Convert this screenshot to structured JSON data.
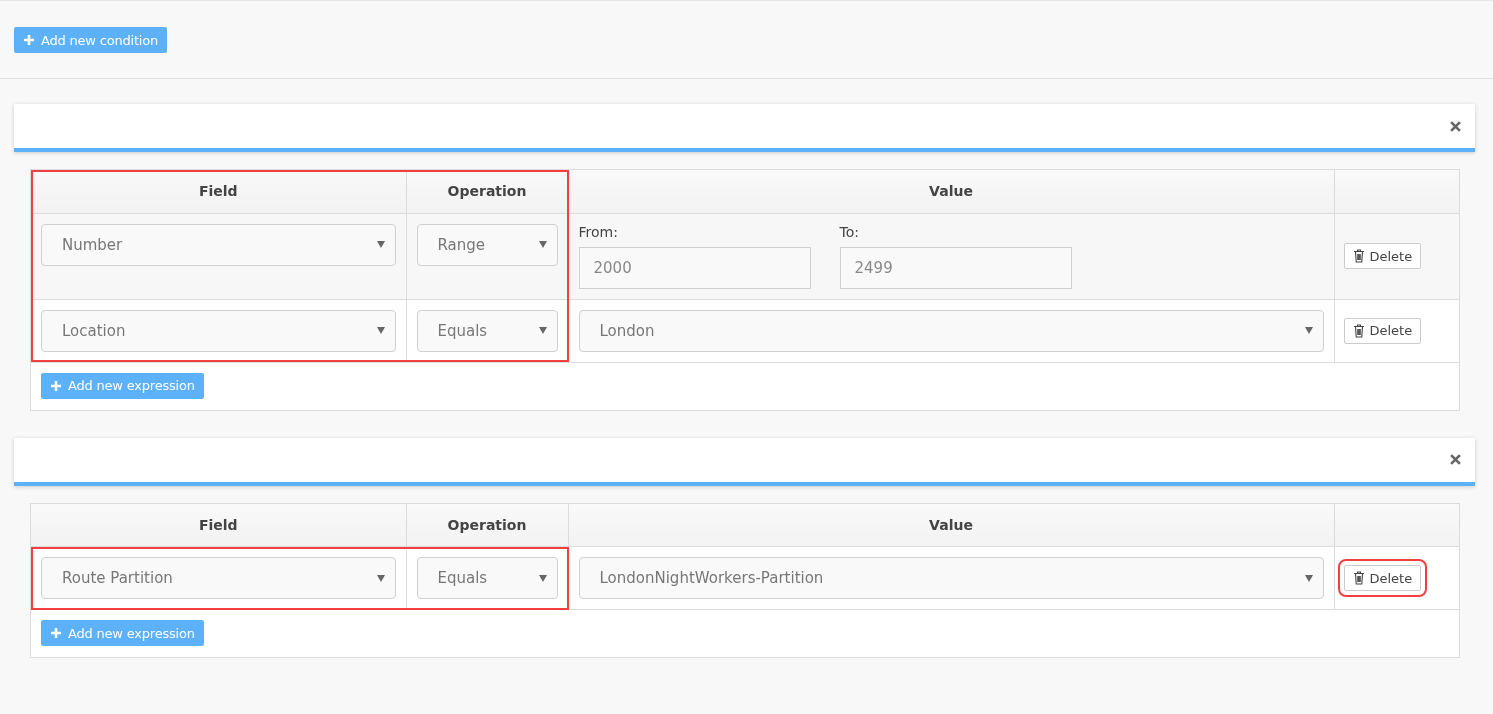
{
  "add_condition_button": {
    "label": "Add new condition"
  },
  "conditions": [
    {
      "columns": [
        "Field",
        "Operation",
        "Value",
        ""
      ],
      "header_highlighted": true,
      "add_expression_button": {
        "label": "Add new expression"
      },
      "rows": [
        {
          "field": "Number",
          "operation": "Range",
          "value": {
            "kind": "range",
            "from_label": "From:",
            "from": "2000",
            "to_label": "To:",
            "to": "2499"
          },
          "highlighted": true,
          "delete": {
            "label": "Delete",
            "highlighted": false
          }
        },
        {
          "field": "Location",
          "operation": "Equals",
          "value": {
            "kind": "select",
            "text": "London"
          },
          "highlighted": true,
          "delete": {
            "label": "Delete",
            "highlighted": false
          }
        }
      ]
    },
    {
      "columns": [
        "Field",
        "Operation",
        "Value",
        ""
      ],
      "header_highlighted": false,
      "add_expression_button": {
        "label": "Add new expression"
      },
      "rows": [
        {
          "field": "Route Partition",
          "operation": "Equals",
          "value": {
            "kind": "select",
            "text": "LondonNightWorkers-Partition"
          },
          "highlighted": true,
          "delete": {
            "label": "Delete",
            "highlighted": true
          }
        }
      ]
    }
  ]
}
